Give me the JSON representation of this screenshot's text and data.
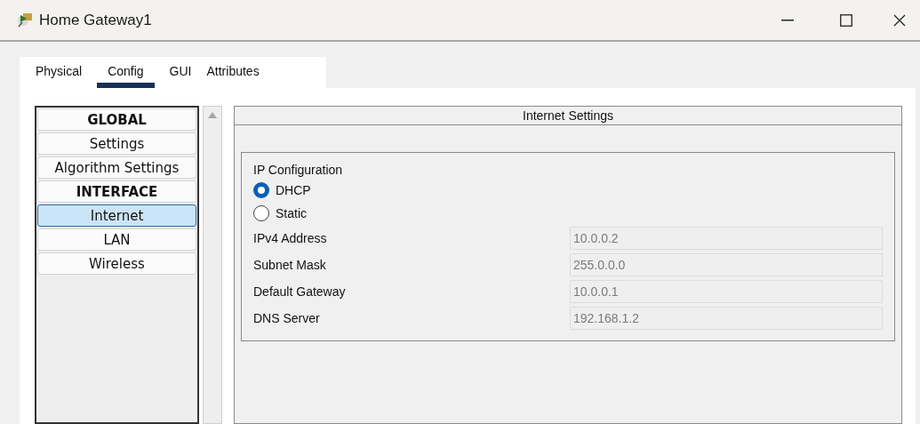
{
  "window": {
    "title": "Home Gateway1"
  },
  "tabs": [
    {
      "label": "Physical",
      "selected": false
    },
    {
      "label": "Config",
      "selected": true
    },
    {
      "label": "GUI",
      "selected": false
    },
    {
      "label": "Attributes",
      "selected": false
    }
  ],
  "sidebar": {
    "items": [
      {
        "kind": "header",
        "label": "GLOBAL",
        "selected": false
      },
      {
        "kind": "item",
        "label": "Settings",
        "selected": false
      },
      {
        "kind": "item",
        "label": "Algorithm Settings",
        "selected": false
      },
      {
        "kind": "header",
        "label": "INTERFACE",
        "selected": false
      },
      {
        "kind": "item",
        "label": "Internet",
        "selected": true
      },
      {
        "kind": "item",
        "label": "LAN",
        "selected": false
      },
      {
        "kind": "item",
        "label": "Wireless",
        "selected": false
      }
    ]
  },
  "panel": {
    "title": "Internet Settings",
    "group_title": "IP Configuration",
    "options": [
      {
        "label": "DHCP",
        "selected": true
      },
      {
        "label": "Static",
        "selected": false
      }
    ],
    "fields": [
      {
        "label": "IPv4 Address",
        "value": "10.0.0.2",
        "disabled": true
      },
      {
        "label": "Subnet Mask",
        "value": "255.0.0.0",
        "disabled": true
      },
      {
        "label": "Default Gateway",
        "value": "10.0.0.1",
        "disabled": true
      },
      {
        "label": "DNS Server",
        "value": "192.168.1.2",
        "disabled": true
      }
    ]
  }
}
